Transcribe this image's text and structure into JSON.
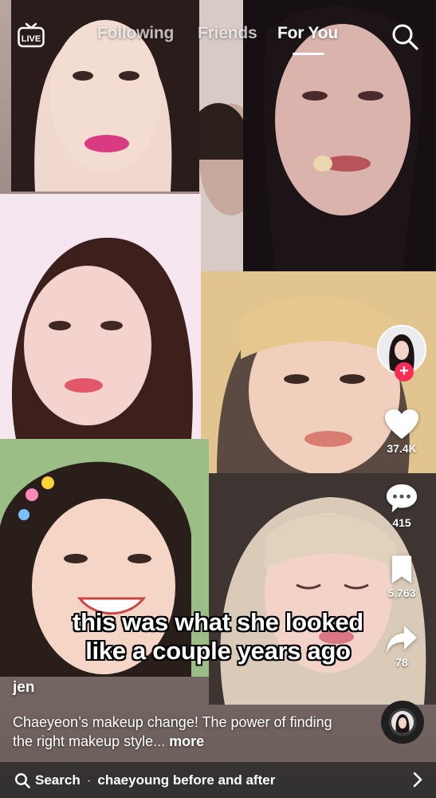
{
  "top_nav": {
    "live_label": "LIVE",
    "tabs": [
      {
        "label": "Following",
        "active": false
      },
      {
        "label": "Friends",
        "active": false
      },
      {
        "label": "For You",
        "active": true
      }
    ]
  },
  "video": {
    "overlay_text": [
      "this was what she looked",
      "like a couple years ago"
    ],
    "username": "jen",
    "description": "Chaeyeon’s makeup change! The power of finding the right makeup style...",
    "more_label": "more"
  },
  "actions": {
    "likes": "37.4K",
    "comments": "415",
    "saves": "5,763",
    "shares": "78"
  },
  "search_bar": {
    "label": "Search",
    "separator": "·",
    "query": "chaeyoung before and after"
  },
  "colors": {
    "follow_accent": "#fe2c55",
    "search_bar_bg": "#282828"
  },
  "icons": [
    "live-icon",
    "search-icon",
    "heart-icon",
    "comment-icon",
    "bookmark-icon",
    "share-icon",
    "plus-icon",
    "chevron-right-icon"
  ]
}
